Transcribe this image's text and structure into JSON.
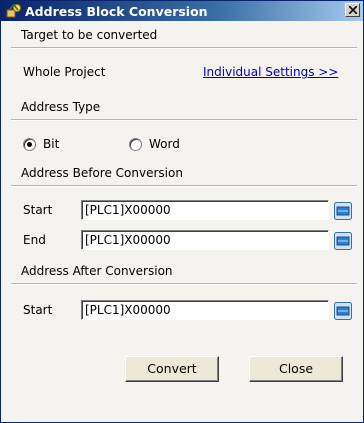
{
  "window": {
    "title": "Address Block Conversion"
  },
  "sections": {
    "target": "Target to be converted",
    "address_type": "Address Type",
    "before": "Address Before Conversion",
    "after": "Address After Conversion"
  },
  "target": {
    "whole_project": "Whole Project",
    "individual_link": "Individual Settings >>"
  },
  "address_type": {
    "bit": "Bit",
    "word": "Word",
    "selected": "Bit"
  },
  "before": {
    "start_label": "Start",
    "start_value": "[PLC1]X00000",
    "end_label": "End",
    "end_value": "[PLC1]X00000"
  },
  "after": {
    "start_label": "Start",
    "start_value": "[PLC1]X00000"
  },
  "buttons": {
    "convert": "Convert",
    "close": "Close"
  }
}
